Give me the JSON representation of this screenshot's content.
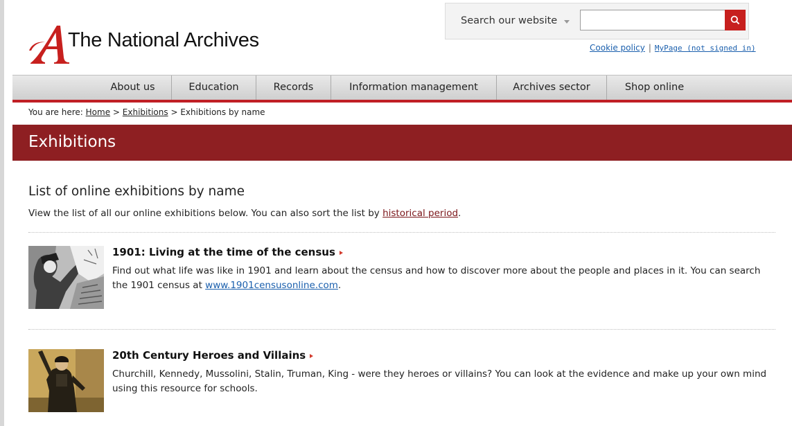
{
  "site": {
    "name": "The National Archives",
    "logo_letter": "A"
  },
  "search": {
    "label": "Search our website",
    "value": "",
    "placeholder": ""
  },
  "top_links": {
    "cookie_policy": "Cookie policy",
    "separator": "|",
    "mypage": "MyPage (not signed in)"
  },
  "nav": {
    "items": [
      {
        "label": "About us"
      },
      {
        "label": "Education"
      },
      {
        "label": "Records"
      },
      {
        "label": "Information management"
      },
      {
        "label": "Archives sector"
      },
      {
        "label": "Shop online"
      }
    ]
  },
  "breadcrumb": {
    "prefix": "You are here:",
    "home": "Home",
    "sep": ">",
    "exhibitions": "Exhibitions",
    "current": "Exhibitions by name"
  },
  "page": {
    "section_title": "Exhibitions",
    "list_title": "List of online exhibitions by name",
    "intro_before": "View the list of all our online exhibitions below. You can also sort the list by ",
    "intro_link": "historical period",
    "intro_after": "."
  },
  "exhibitions": [
    {
      "title": "1901: Living at the time of the census",
      "desc_before": "Find out what life was like in 1901 and learn about the census and how to discover more about the people and places in it. You can search the 1901 census at ",
      "desc_link": "www.1901censusonline.com",
      "desc_after": "."
    },
    {
      "title": "20th Century Heroes and Villains",
      "desc_before": "Churchill, Kennedy, Mussolini, Stalin, Truman, King - were they heroes or villains? You can look at the evidence and make up your own mind using this resource for schools.",
      "desc_link": "",
      "desc_after": ""
    }
  ],
  "colors": {
    "brand_red": "#c7201e",
    "band": "#8e1f22",
    "link_blue": "#1a5fad",
    "link_red": "#7a1418"
  }
}
